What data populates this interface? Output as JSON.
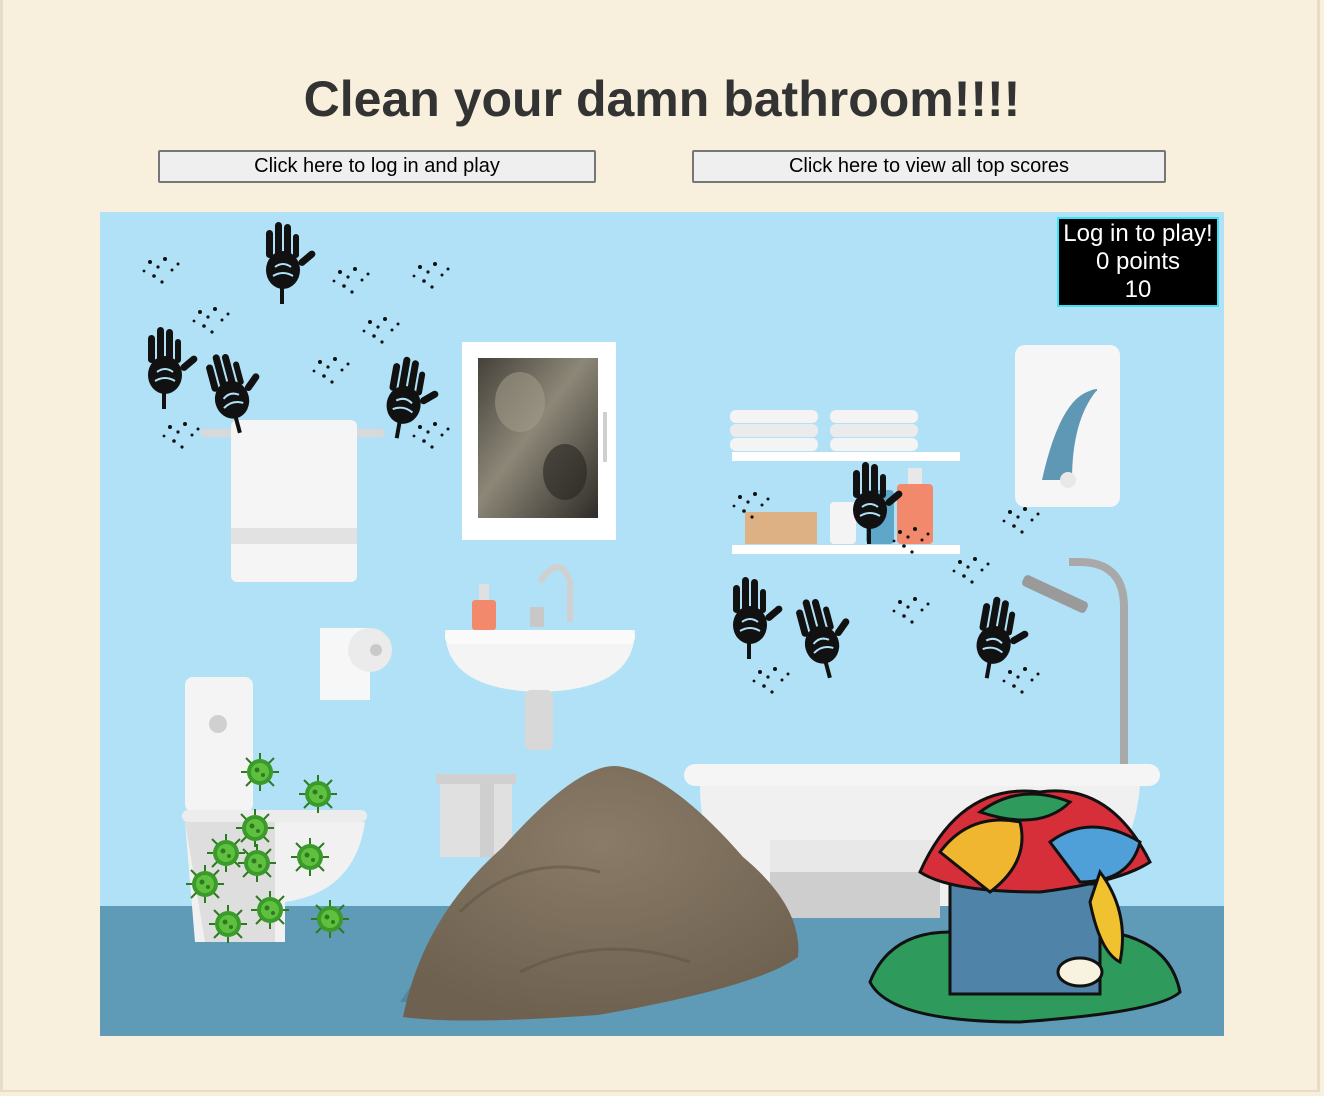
{
  "page": {
    "title": "Clean your damn bathroom!!!!",
    "login_button": "Click here to log in and play",
    "scores_button": "Click here to view all top scores"
  },
  "hud": {
    "status": "Log in to play!",
    "points": "0 points",
    "timer": "10"
  },
  "colors": {
    "background": "#f8efdd",
    "wall": "#b0e1f7",
    "floor": "#5f9bb6",
    "hud_bg": "#000000",
    "hud_border": "#3fe0f0"
  },
  "scene": {
    "messes": [
      "handprints",
      "germs",
      "dirt-pile",
      "laundry-pile",
      "mold"
    ],
    "fixtures": [
      "towel-rack",
      "mirror-cabinet",
      "sink",
      "toilet",
      "toilet-paper",
      "shelf",
      "water-heater",
      "bathtub",
      "shower",
      "trash-can"
    ]
  }
}
